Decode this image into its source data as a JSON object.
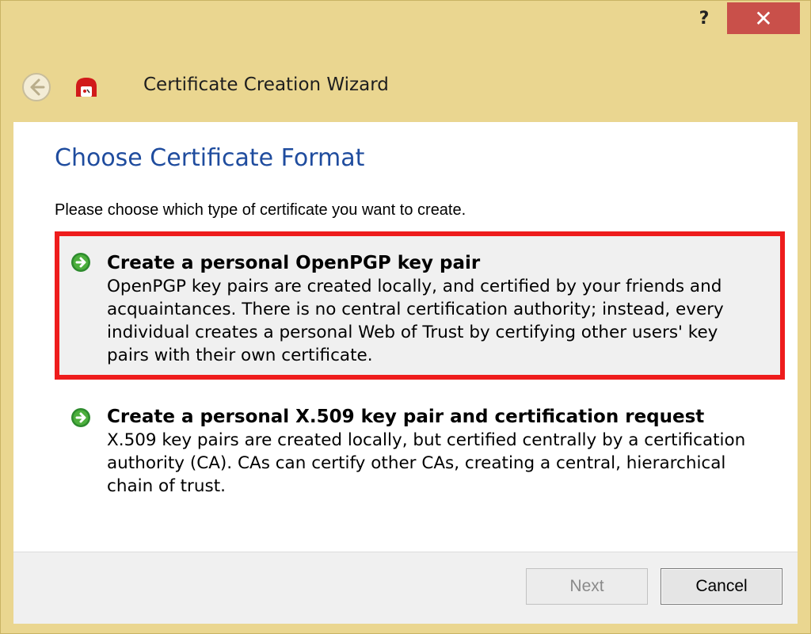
{
  "window": {
    "help_label": "?",
    "close_label": "✕",
    "title": "Certificate Creation Wizard"
  },
  "page": {
    "title": "Choose Certificate Format",
    "instruction": "Please choose which type of certificate you want to create."
  },
  "options": [
    {
      "title": "Create a personal OpenPGP key pair",
      "description": "OpenPGP key pairs are created locally, and certified by your friends and acquaintances. There is no central certification authority; instead, every individual creates a personal Web of Trust by certifying other users' key pairs with their own certificate.",
      "selected": true
    },
    {
      "title": "Create a personal X.509 key pair and certification request",
      "description": "X.509 key pairs are created locally, but certified centrally by a certification authority (CA). CAs can certify other CAs, creating a central, hierarchical chain of trust.",
      "selected": false
    }
  ],
  "buttons": {
    "next": "Next",
    "cancel": "Cancel"
  },
  "colors": {
    "title_bar": "#ead690",
    "close": "#c9504a",
    "page_title": "#1f4c9e",
    "selection_border": "#ee1c1c",
    "arrow": "#2e8b2e"
  },
  "icons": {
    "back": "back-arrow-icon",
    "app": "kleopatra-app-icon",
    "option": "green-arrow-icon"
  }
}
